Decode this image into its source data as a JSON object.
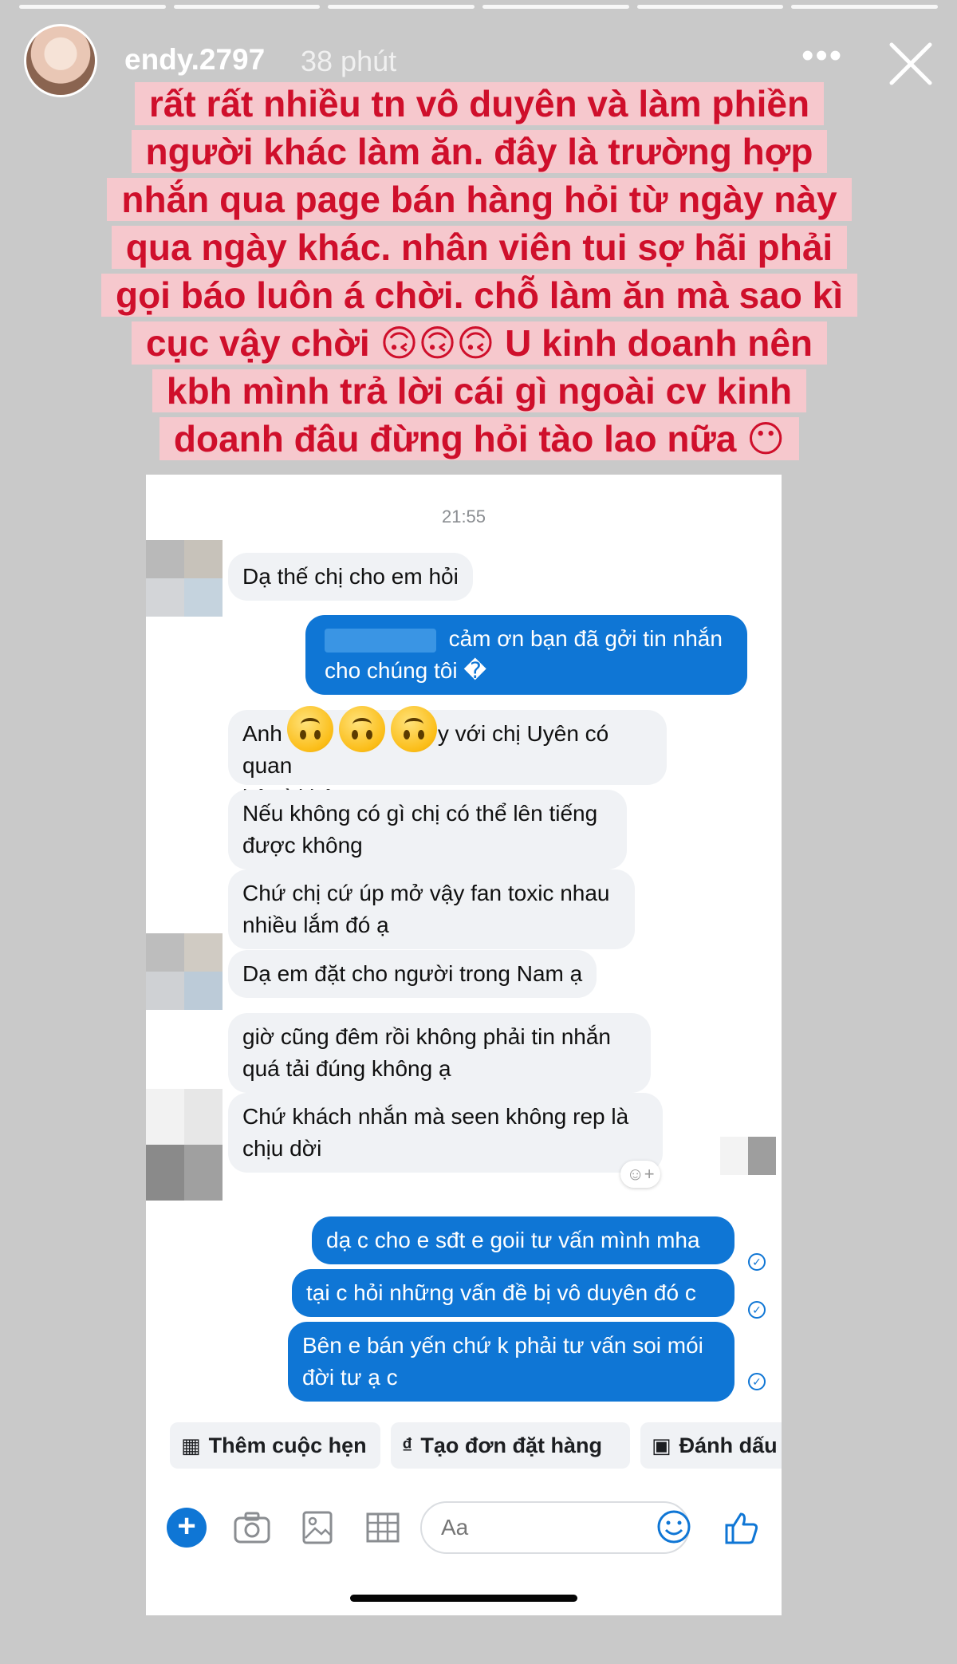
{
  "story": {
    "username": "endy.2797",
    "time": "38 phút",
    "more_icon": "more-horizontal-icon",
    "close_icon": "close-icon",
    "progress_segments": 6,
    "caption_lines": [
      "rất rất nhiều tn vô duyên và làm phiền",
      "người khác làm ăn. đây là trường hợp",
      "nhắn qua page bán hàng hỏi từ ngày này",
      "qua ngày khác. nhân viên tui sợ hãi phải",
      "gọi báo luôn á chời. chỗ làm ăn mà sao kì",
      "cục vậy chời 🙃🙃🙃 U kinh doanh nên",
      "kbh mình trả lời cái gì ngoài cv kinh",
      "doanh đâu đừng hỏi tào lao nữa 😶"
    ],
    "caption_color": "#cf0f2b",
    "caption_bg": "#f6c8cd"
  },
  "chat": {
    "timestamp": "21:55",
    "messages": {
      "m1": "Dạ thế chị cho em hỏi",
      "m2a": "cảm ơn bạn đã gởi tin nhắn",
      "m2b": "cho chúng tôi �",
      "m3a": "Anh",
      "m3b": "y với chị Uyên có quan",
      "m3c": "hệ gì không ạ",
      "m4": "Nếu không có gì chị có thể lên tiếng được không",
      "m5": "Chứ chị cứ úp mở vậy fan toxic nhau nhiều lắm đó ạ",
      "m6": "Dạ em đặt cho người trong Nam ạ",
      "m7": "giờ cũng đêm rồi không phải tin nhắn quá tải đúng không ạ",
      "m8": "Chứ khách nhắn mà seen không rep là chịu dời",
      "r1": "dạ c cho e sđt e goii tư vấn mình mha",
      "r2": "tại c hỏi những vấn đề bị vô duyên đó c",
      "r3": "Bên e bán yến chứ k phải tư vấn soi mói đời tư ạ c"
    },
    "chips": {
      "appointment": "Thêm cuộc hẹn",
      "order": "Tạo đơn đặt hàng",
      "mark": "Đánh dấu"
    },
    "chip_icons": [
      "calendar-icon",
      "dong-icon",
      "label-icon"
    ],
    "composer": {
      "placeholder": "Aa",
      "icons": [
        "plus-icon",
        "camera-icon",
        "image-icon",
        "grid-icon",
        "emoji-icon",
        "thumbs-up-icon"
      ]
    },
    "accent": "#0f76d5"
  }
}
